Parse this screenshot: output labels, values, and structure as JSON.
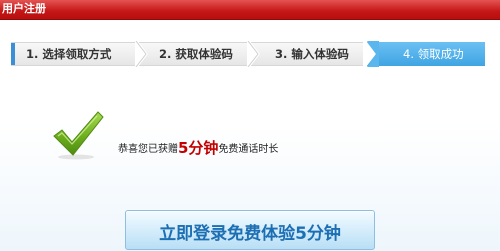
{
  "window": {
    "title": "用户注册"
  },
  "steps": [
    {
      "label": "1. 选择领取方式"
    },
    {
      "label": "2. 获取体验码"
    },
    {
      "label": "3. 输入体验码"
    },
    {
      "label": "4. 领取成功"
    }
  ],
  "success": {
    "prefix": "恭喜您已获赠",
    "highlight": "5分钟",
    "suffix": "免费通话时长"
  },
  "login_button": {
    "label": "立即登录免费体验5分钟"
  },
  "colors": {
    "titlebar": "#c41616",
    "active_step": "#4aaee8",
    "highlight": "#c40000",
    "check": "#6aac1c"
  },
  "icons": {
    "success": "checkmark-icon"
  }
}
